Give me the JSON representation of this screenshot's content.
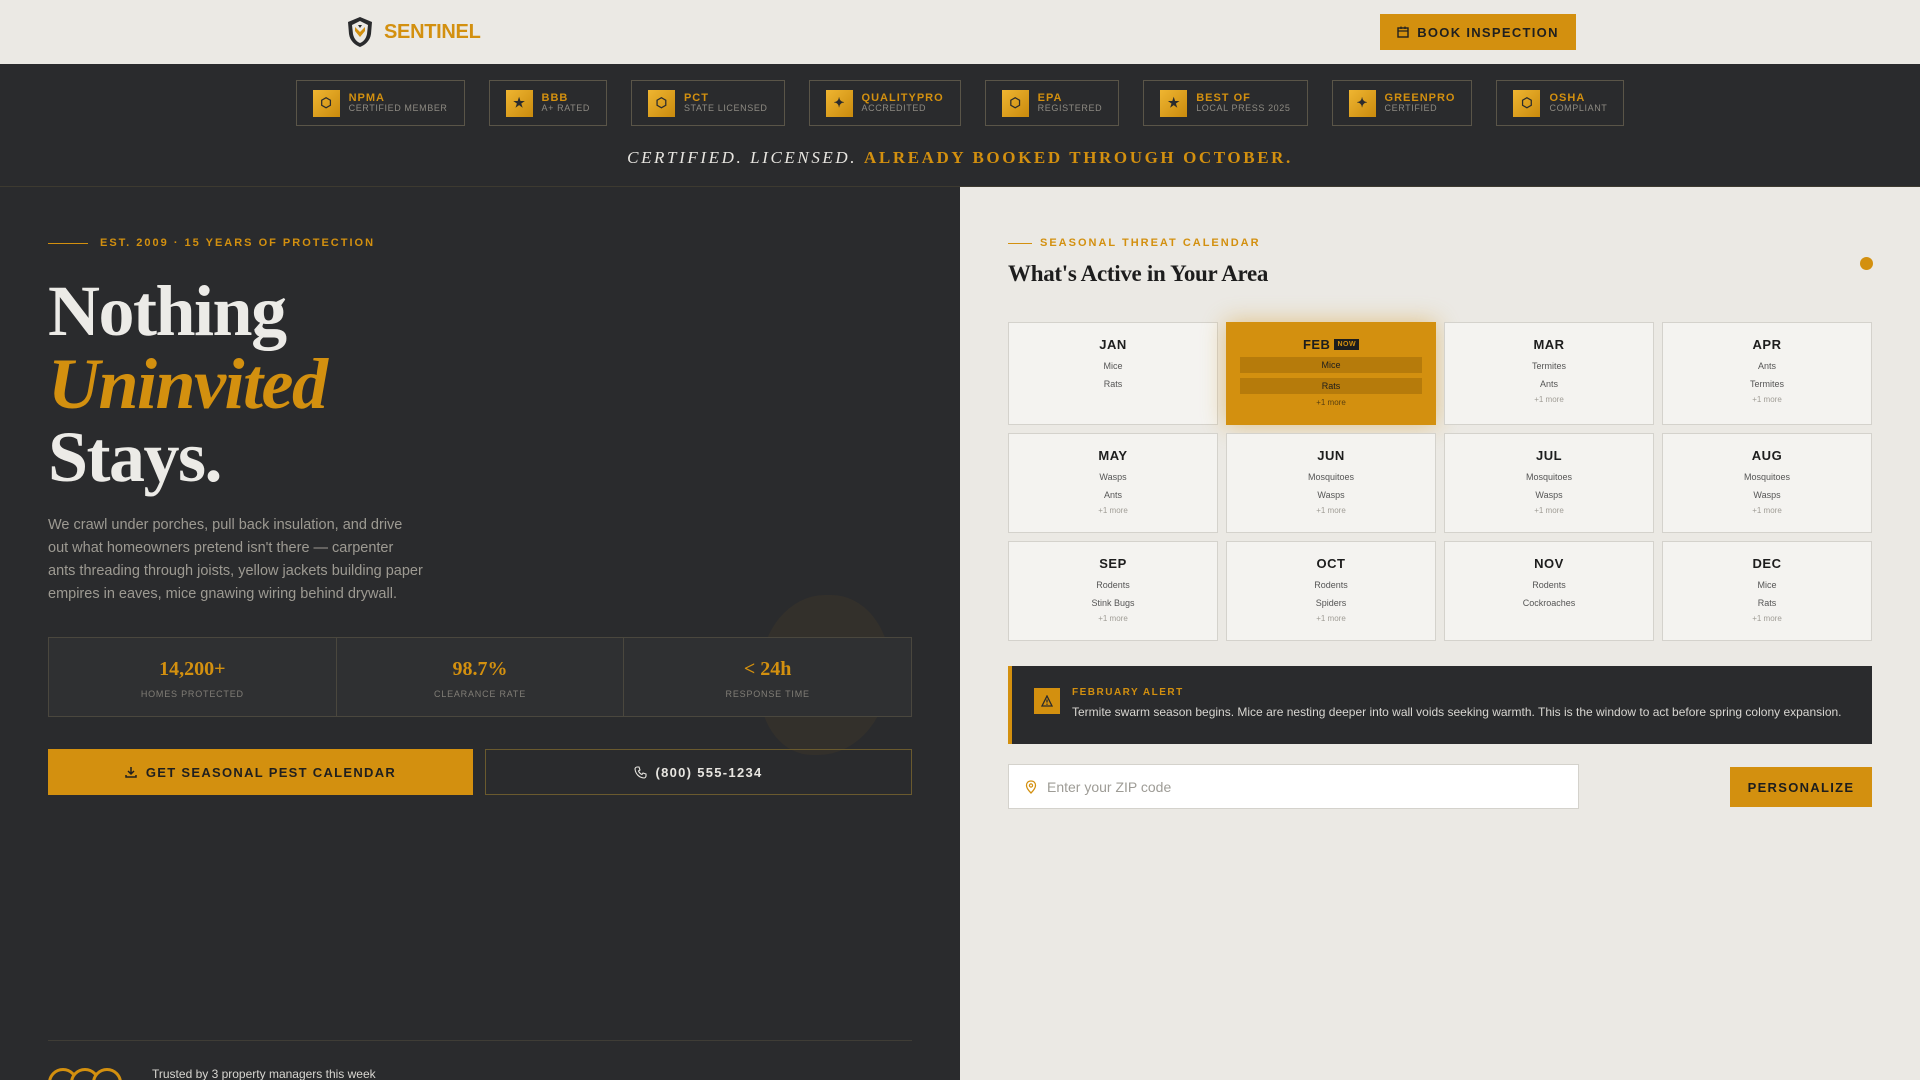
{
  "brand": {
    "name": "SENTINEL",
    "logo_icon": "shield-crest-icon"
  },
  "header": {
    "book_label": "BOOK INSPECTION",
    "book_icon": "calendar-icon"
  },
  "credentials": [
    {
      "name": "NPMA",
      "sub": "CERTIFIED MEMBER",
      "icon": "⬡"
    },
    {
      "name": "BBB",
      "sub": "A+ RATED",
      "icon": "★"
    },
    {
      "name": "PCT",
      "sub": "STATE LICENSED",
      "icon": "⬡"
    },
    {
      "name": "QUALITYPRO",
      "sub": "ACCREDITED",
      "icon": "✦"
    },
    {
      "name": "EPA",
      "sub": "REGISTERED",
      "icon": "⬡"
    },
    {
      "name": "BEST OF",
      "sub": "LOCAL PRESS 2025",
      "icon": "★"
    },
    {
      "name": "GREENPRO",
      "sub": "CERTIFIED",
      "icon": "✦"
    },
    {
      "name": "OSHA",
      "sub": "COMPLIANT",
      "icon": "⬡"
    }
  ],
  "tagline": {
    "part1": "CERTIFIED. LICENSED.",
    "part2": "ALREADY BOOKED THROUGH OCTOBER."
  },
  "hero": {
    "eyebrow": "EST. 2009 · 15 YEARS OF PROTECTION",
    "headline_line1": "Nothing",
    "headline_accent": "Uninvited",
    "headline_line3": "Stays.",
    "body": "We crawl under porches, pull back insulation, and drive out what homeowners pretend isn't there — carpenter ants threading through joists, yellow jackets building paper empires in eaves, mice gnawing wiring behind drywall.",
    "stats": [
      {
        "value": "14,200+",
        "label": "HOMES PROTECTED"
      },
      {
        "value": "98.7%",
        "label": "CLEARANCE RATE"
      },
      {
        "value": "< 24h",
        "label": "RESPONSE TIME"
      }
    ],
    "cta_primary": "GET SEASONAL PEST CALENDAR",
    "cta_phone": "(800) 555-1234",
    "trust": "Trusted by 3 property managers this week"
  },
  "calendar": {
    "eyebrow": "SEASONAL THREAT CALENDAR",
    "title": "What's Active in Your Area",
    "now_label": "NOW",
    "months": [
      {
        "name": "JAN",
        "pests": [
          "Mice",
          "Rats"
        ],
        "more": ""
      },
      {
        "name": "FEB",
        "pests": [
          "Mice",
          "Rats"
        ],
        "more": "+1 more",
        "active": true
      },
      {
        "name": "MAR",
        "pests": [
          "Termites",
          "Ants"
        ],
        "more": "+1 more"
      },
      {
        "name": "APR",
        "pests": [
          "Ants",
          "Termites"
        ],
        "more": "+1 more"
      },
      {
        "name": "MAY",
        "pests": [
          "Wasps",
          "Ants"
        ],
        "more": "+1 more"
      },
      {
        "name": "JUN",
        "pests": [
          "Mosquitoes",
          "Wasps"
        ],
        "more": "+1 more"
      },
      {
        "name": "JUL",
        "pests": [
          "Mosquitoes",
          "Wasps"
        ],
        "more": "+1 more"
      },
      {
        "name": "AUG",
        "pests": [
          "Mosquitoes",
          "Wasps"
        ],
        "more": "+1 more"
      },
      {
        "name": "SEP",
        "pests": [
          "Rodents",
          "Stink Bugs"
        ],
        "more": "+1 more"
      },
      {
        "name": "OCT",
        "pests": [
          "Rodents",
          "Spiders"
        ],
        "more": "+1 more"
      },
      {
        "name": "NOV",
        "pests": [
          "Rodents",
          "Cockroaches"
        ],
        "more": ""
      },
      {
        "name": "DEC",
        "pests": [
          "Mice",
          "Rats"
        ],
        "more": "+1 more"
      }
    ],
    "alert": {
      "title": "FEBRUARY ALERT",
      "text": "Termite swarm season begins. Mice are nesting deeper into wall voids seeking warmth. This is the window to act before spring colony expansion."
    },
    "zip_placeholder": "Enter your ZIP code",
    "personalize_label": "PERSONALIZE"
  },
  "colors": {
    "accent": "#d3900f",
    "dark": "#2a2b2d",
    "light": "#ebe9e4"
  }
}
